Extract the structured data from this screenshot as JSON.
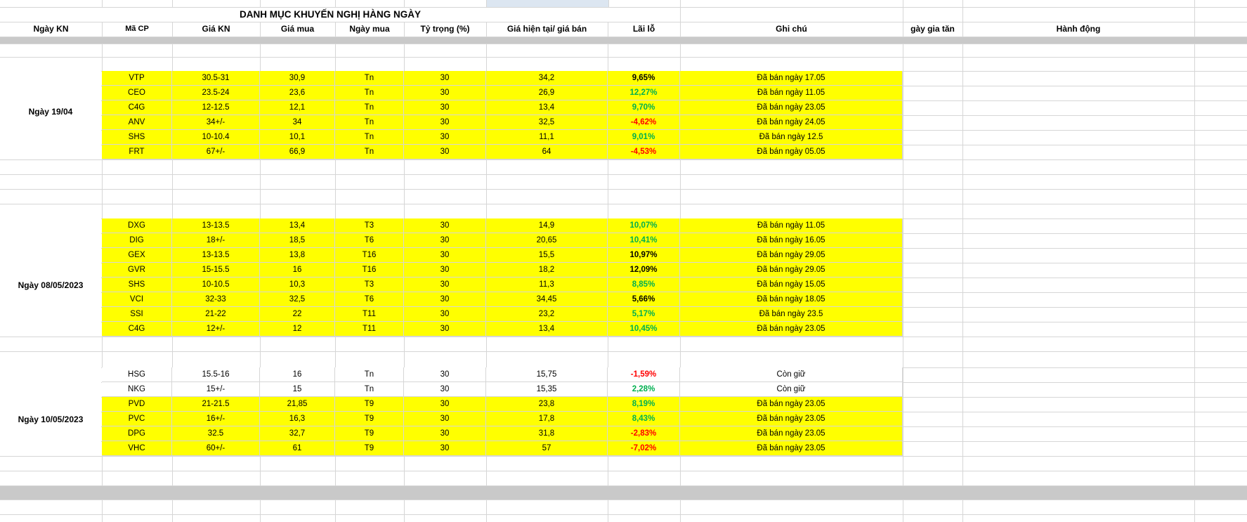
{
  "sheet": {
    "title": "DANH MỤC KHUYẾN NGHỊ HÀNG NGÀY",
    "columns": [
      "Ngày KN",
      "Mã CP",
      "Giá KN",
      "Giá mua",
      "Ngày mua",
      "Tỷ trọng (%)",
      "Giá hiện tại/ giá bán",
      "Lãi lỗ",
      "Ghi chú",
      "gày gia tăn",
      "Hành động"
    ],
    "colors": {
      "highlight": "#FFFF00",
      "gain": "#00B050",
      "loss": "#FF0000",
      "neutral": "#000000",
      "selected_cell": "#DCE6F1",
      "separator_band": "#C9C9C9"
    },
    "groups": [
      {
        "date": "Ngày 19/04",
        "rows": [
          {
            "code": "VTP",
            "gia_kn": "30.5-31",
            "gia_mua": "30,9",
            "ngay_mua": "Tn",
            "ty_trong": "30",
            "gia_hien_tai": "34,2",
            "lai_lo": "9,65%",
            "lai_lo_color": "neutral",
            "ghi_chu": "Đã bán ngày 17.05",
            "highlight": true
          },
          {
            "code": "CEO",
            "gia_kn": "23.5-24",
            "gia_mua": "23,6",
            "ngay_mua": "Tn",
            "ty_trong": "30",
            "gia_hien_tai": "26,9",
            "lai_lo": "12,27%",
            "lai_lo_color": "gain",
            "ghi_chu": "Đã bán ngày 11.05",
            "highlight": true
          },
          {
            "code": "C4G",
            "gia_kn": "12-12.5",
            "gia_mua": "12,1",
            "ngay_mua": "Tn",
            "ty_trong": "30",
            "gia_hien_tai": "13,4",
            "lai_lo": "9,70%",
            "lai_lo_color": "gain",
            "ghi_chu": "Đã bán ngày 23.05",
            "highlight": true
          },
          {
            "code": "ANV",
            "gia_kn": "34+/-",
            "gia_mua": "34",
            "ngay_mua": "Tn",
            "ty_trong": "30",
            "gia_hien_tai": "32,5",
            "lai_lo": "-4,62%",
            "lai_lo_color": "loss",
            "ghi_chu": "Đã bán ngày 24.05",
            "highlight": true
          },
          {
            "code": "SHS",
            "gia_kn": "10-10.4",
            "gia_mua": "10,1",
            "ngay_mua": "Tn",
            "ty_trong": "30",
            "gia_hien_tai": "11,1",
            "lai_lo": "9,01%",
            "lai_lo_color": "gain",
            "ghi_chu": "Đã bán ngày 12.5",
            "highlight": true
          },
          {
            "code": "FRT",
            "gia_kn": "67+/-",
            "gia_mua": "66,9",
            "ngay_mua": "Tn",
            "ty_trong": "30",
            "gia_hien_tai": "64",
            "lai_lo": "-4,53%",
            "lai_lo_color": "loss",
            "ghi_chu": "Đã bán ngày 05.05",
            "highlight": true
          }
        ]
      },
      {
        "date": "Ngày 08/05/2023",
        "rows": [
          {
            "code": "DXG",
            "gia_kn": "13-13.5",
            "gia_mua": "13,4",
            "ngay_mua": "T3",
            "ty_trong": "30",
            "gia_hien_tai": "14,9",
            "lai_lo": "10,07%",
            "lai_lo_color": "gain",
            "ghi_chu": "Đã bán ngày 11.05",
            "highlight": true
          },
          {
            "code": "DIG",
            "gia_kn": "18+/-",
            "gia_mua": "18,5",
            "ngay_mua": "T6",
            "ty_trong": "30",
            "gia_hien_tai": "20,65",
            "lai_lo": "10,41%",
            "lai_lo_color": "gain",
            "ghi_chu": "Đã bán ngày 16.05",
            "highlight": true
          },
          {
            "code": "GEX",
            "gia_kn": "13-13.5",
            "gia_mua": "13,8",
            "ngay_mua": "T16",
            "ty_trong": "30",
            "gia_hien_tai": "15,5",
            "lai_lo": "10,97%",
            "lai_lo_color": "neutral",
            "ghi_chu": "Đã bán ngày 29.05",
            "highlight": true
          },
          {
            "code": "GVR",
            "gia_kn": "15-15.5",
            "gia_mua": "16",
            "ngay_mua": "T16",
            "ty_trong": "30",
            "gia_hien_tai": "18,2",
            "lai_lo": "12,09%",
            "lai_lo_color": "neutral",
            "ghi_chu": "Đã bán ngày 29.05",
            "highlight": true
          },
          {
            "code": "SHS",
            "gia_kn": "10-10.5",
            "gia_mua": "10,3",
            "ngay_mua": "T3",
            "ty_trong": "30",
            "gia_hien_tai": "11,3",
            "lai_lo": "8,85%",
            "lai_lo_color": "gain",
            "ghi_chu": "Đã bán ngày 15.05",
            "highlight": true
          },
          {
            "code": "VCI",
            "gia_kn": "32-33",
            "gia_mua": "32,5",
            "ngay_mua": "T6",
            "ty_trong": "30",
            "gia_hien_tai": "34,45",
            "lai_lo": "5,66%",
            "lai_lo_color": "neutral",
            "ghi_chu": "Đã bán ngày 18.05",
            "highlight": true
          },
          {
            "code": "SSI",
            "gia_kn": "21-22",
            "gia_mua": "22",
            "ngay_mua": "T11",
            "ty_trong": "30",
            "gia_hien_tai": "23,2",
            "lai_lo": "5,17%",
            "lai_lo_color": "gain",
            "ghi_chu": "Đã bán ngày 23.5",
            "highlight": true
          },
          {
            "code": "C4G",
            "gia_kn": "12+/-",
            "gia_mua": "12",
            "ngay_mua": "T11",
            "ty_trong": "30",
            "gia_hien_tai": "13,4",
            "lai_lo": "10,45%",
            "lai_lo_color": "gain",
            "ghi_chu": "Đã bán ngày 23.05",
            "highlight": true
          }
        ]
      },
      {
        "date": "Ngày 10/05/2023",
        "rows": [
          {
            "code": "HSG",
            "gia_kn": "15.5-16",
            "gia_mua": "16",
            "ngay_mua": "Tn",
            "ty_trong": "30",
            "gia_hien_tai": "15,75",
            "lai_lo": "-1,59%",
            "lai_lo_color": "loss",
            "ghi_chu": "Còn giữ",
            "highlight": false
          },
          {
            "code": "NKG",
            "gia_kn": "15+/-",
            "gia_mua": "15",
            "ngay_mua": "Tn",
            "ty_trong": "30",
            "gia_hien_tai": "15,35",
            "lai_lo": "2,28%",
            "lai_lo_color": "gain",
            "ghi_chu": "Còn giữ",
            "highlight": false
          },
          {
            "code": "PVD",
            "gia_kn": "21-21.5",
            "gia_mua": "21,85",
            "ngay_mua": "T9",
            "ty_trong": "30",
            "gia_hien_tai": "23,8",
            "lai_lo": "8,19%",
            "lai_lo_color": "gain",
            "ghi_chu": "Đã bán ngày 23.05",
            "highlight": true
          },
          {
            "code": "PVC",
            "gia_kn": "16+/-",
            "gia_mua": "16,3",
            "ngay_mua": "T9",
            "ty_trong": "30",
            "gia_hien_tai": "17,8",
            "lai_lo": "8,43%",
            "lai_lo_color": "gain",
            "ghi_chu": "Đã bán ngày 23.05",
            "highlight": true
          },
          {
            "code": "DPG",
            "gia_kn": "32.5",
            "gia_mua": "32,7",
            "ngay_mua": "T9",
            "ty_trong": "30",
            "gia_hien_tai": "31,8",
            "lai_lo": "-2,83%",
            "lai_lo_color": "loss",
            "ghi_chu": "Đã bán ngày 23.05",
            "highlight": true
          },
          {
            "code": "VHC",
            "gia_kn": "60+/-",
            "gia_mua": "61",
            "ngay_mua": "T9",
            "ty_trong": "30",
            "gia_hien_tai": "57",
            "lai_lo": "-7,02%",
            "lai_lo_color": "loss",
            "ghi_chu": "Đã bán ngày 23.05",
            "highlight": true
          }
        ]
      }
    ]
  }
}
